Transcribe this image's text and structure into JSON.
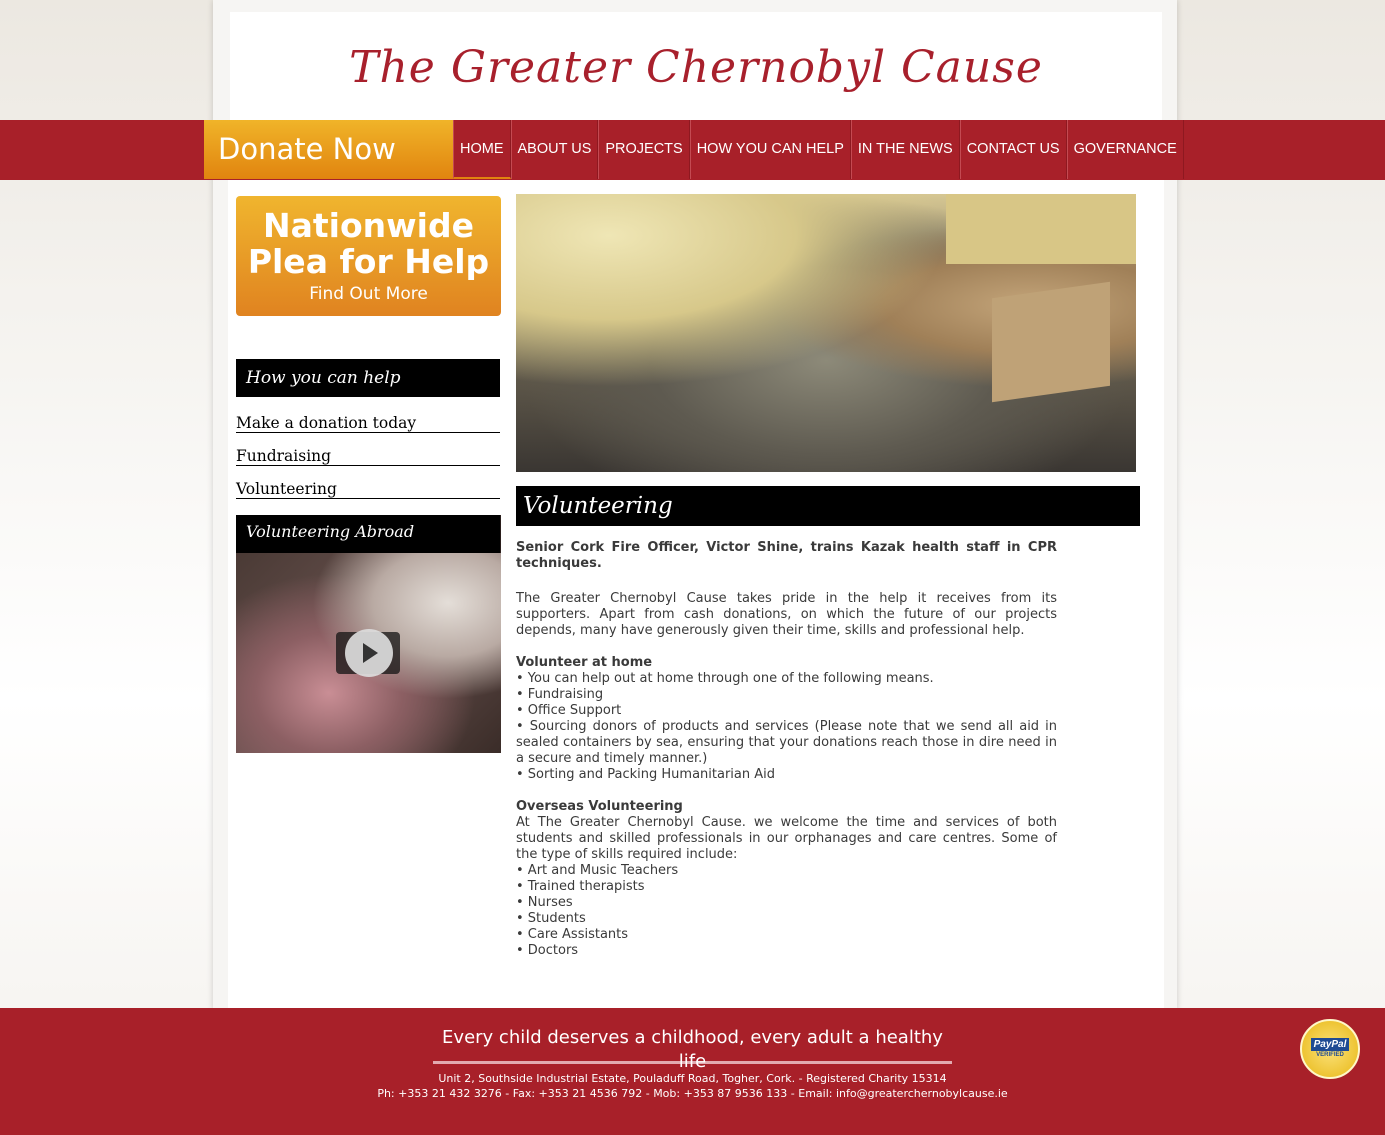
{
  "site": {
    "title": "The Greater Chernobyl Cause"
  },
  "nav": {
    "donate_label": "Donate Now",
    "items": [
      {
        "label": "HOME"
      },
      {
        "label": "ABOUT US"
      },
      {
        "label": "PROJECTS"
      },
      {
        "label": "HOW YOU CAN HELP"
      },
      {
        "label": "IN THE NEWS"
      },
      {
        "label": "CONTACT US"
      },
      {
        "label": "GOVERNANCE"
      }
    ],
    "active": "HOME"
  },
  "sidebar": {
    "plea_title_line1": "Nationwide",
    "plea_title_line2": "Plea for Help",
    "plea_sub": "Find Out More",
    "heading": "How you can help",
    "links": [
      {
        "label": "Make a donation today"
      },
      {
        "label": "Fundraising"
      },
      {
        "label": "Volunteering"
      }
    ],
    "video_title": "Volunteering Abroad"
  },
  "main": {
    "heading": "Volunteering",
    "lead": "Senior Cork Fire Officer, Victor Shine, trains Kazak health staff in CPR techniques.",
    "intro": "The Greater Chernobyl Cause takes pride in the help it receives from its supporters. Apart from cash donations, on which the future of our projects depends, many have generously given their time, skills and professional help.",
    "home_heading": "Volunteer at home",
    "home_items": [
      "• You can help out at home through one of the following means.",
      "• Fundraising",
      "• Office Support",
      "• Sourcing donors of products and services (Please note that we send all aid in sealed containers by sea, ensuring that your donations reach those in dire need in a secure and timely manner.)",
      "• Sorting and Packing Humanitarian Aid"
    ],
    "overseas_heading": "Overseas Volunteering",
    "overseas_intro": "At The Greater Chernobyl Cause. we welcome the time and services of both students and skilled professionals in our orphanages and care centres. Some of the type of skills required include:",
    "overseas_items": [
      "• Art and Music Teachers",
      "• Trained therapists",
      "• Nurses",
      "• Students",
      "• Care Assistants",
      "• Doctors"
    ]
  },
  "footer": {
    "tagline": "Every child deserves a childhood, every adult a healthy life",
    "address": "Unit 2, Southside Industrial Estate, Pouladuff Road, Togher, Cork. - Registered Charity 15314",
    "contact": "Ph: +353 21 432 3276 - Fax: +353 21 4536 792 - Mob: +353 87 9536 133 - Email: info@greaterchernobylcause.ie",
    "badge_brand": "PayPal",
    "badge_text": "VERIFIED"
  },
  "colors": {
    "brand_red": "#a82029",
    "accent_orange": "#e1840f",
    "title_red": "#a8202c"
  }
}
